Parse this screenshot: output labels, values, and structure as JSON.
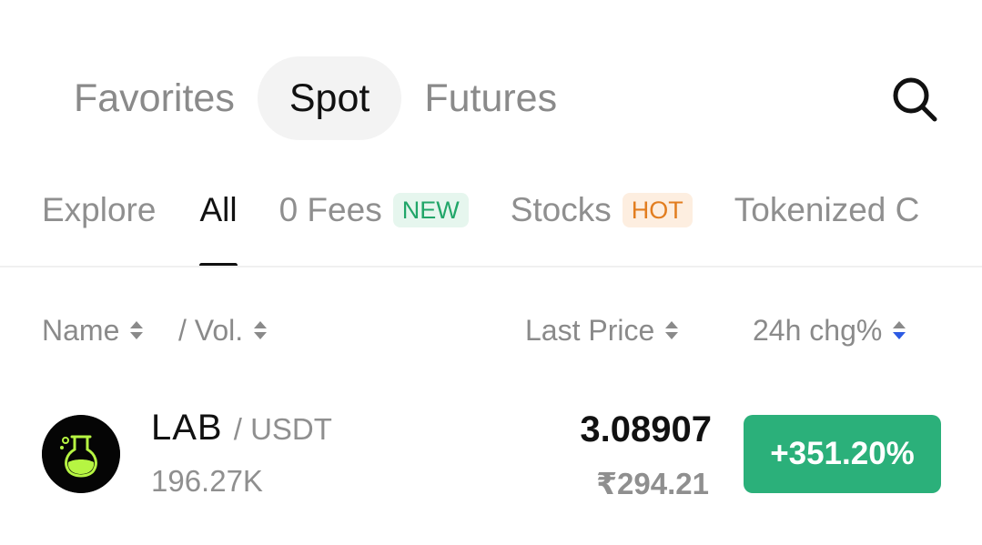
{
  "top_tabs": [
    {
      "label": "Favorites"
    },
    {
      "label": "Spot"
    },
    {
      "label": "Futures"
    }
  ],
  "active_top_tab": "Spot",
  "sub_tabs": [
    {
      "label": "Explore"
    },
    {
      "label": "All"
    },
    {
      "label": "0 Fees",
      "badge": "NEW"
    },
    {
      "label": "Stocks",
      "badge": "HOT"
    },
    {
      "label": "Tokenized C"
    }
  ],
  "active_sub_tab": "All",
  "columns": {
    "name": "Name",
    "vol": "/ Vol.",
    "last_price": "Last Price",
    "change": "24h chg%"
  },
  "rows": [
    {
      "base": "LAB",
      "quote": "/ USDT",
      "volume": "196.27K",
      "price": "3.08907",
      "price_fiat": "₹294.21",
      "change": "+351.20%",
      "change_color": "#2bb07a",
      "icon": "flask-icon"
    }
  ],
  "colors": {
    "accent_sort": "#2d5be3",
    "positive": "#2bb07a",
    "new_badge": "#21a669",
    "hot_badge": "#e27d1f"
  }
}
